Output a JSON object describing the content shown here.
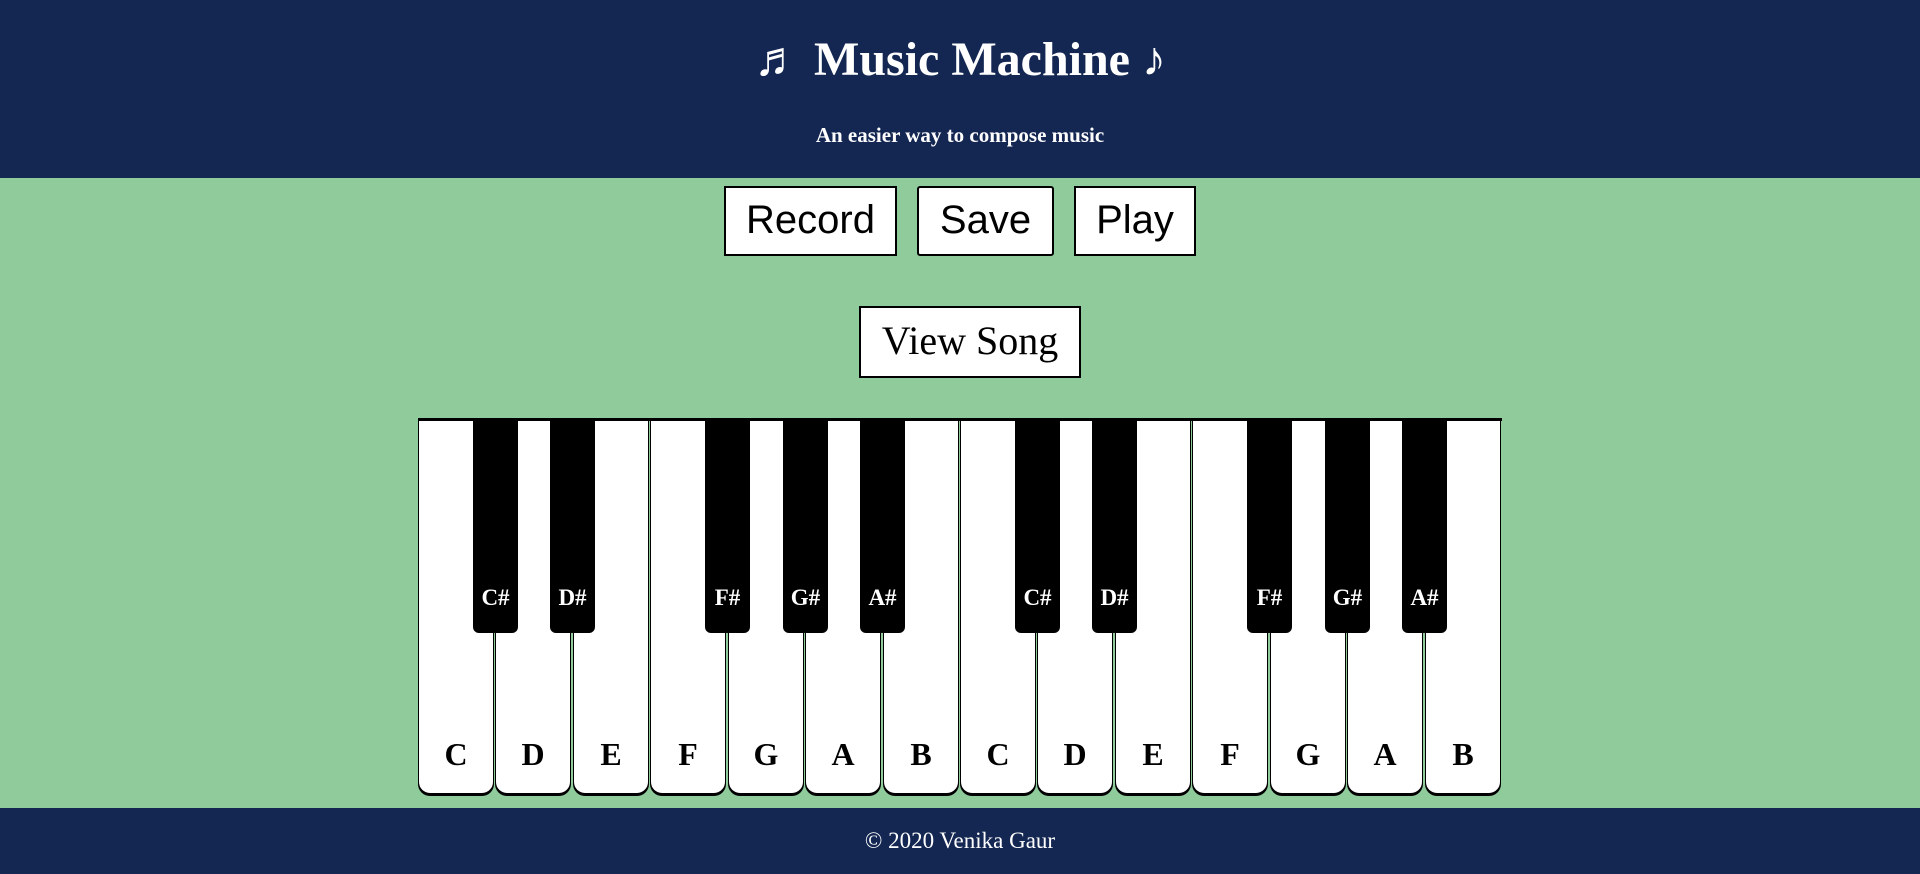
{
  "header": {
    "title": "♬ Music Machine ♪",
    "subtitle": "An easier way to compose music"
  },
  "controls": {
    "record_label": "Record",
    "save_label": "Save",
    "play_label": "Play",
    "view_song_label": "View Song"
  },
  "piano": {
    "white_keys": [
      "C",
      "D",
      "E",
      "F",
      "G",
      "A",
      "B",
      "C",
      "D",
      "E",
      "F",
      "G",
      "A",
      "B"
    ],
    "black_keys": [
      "C#",
      "D#",
      "F#",
      "G#",
      "A#",
      "C#",
      "D#",
      "F#",
      "G#",
      "A#"
    ]
  },
  "footer": {
    "copyright": "© 2020 Venika Gaur"
  },
  "colors": {
    "header_bg": "#142752",
    "body_bg": "#8fcb9b",
    "white_key": "#ffffff",
    "black_key": "#000000"
  }
}
